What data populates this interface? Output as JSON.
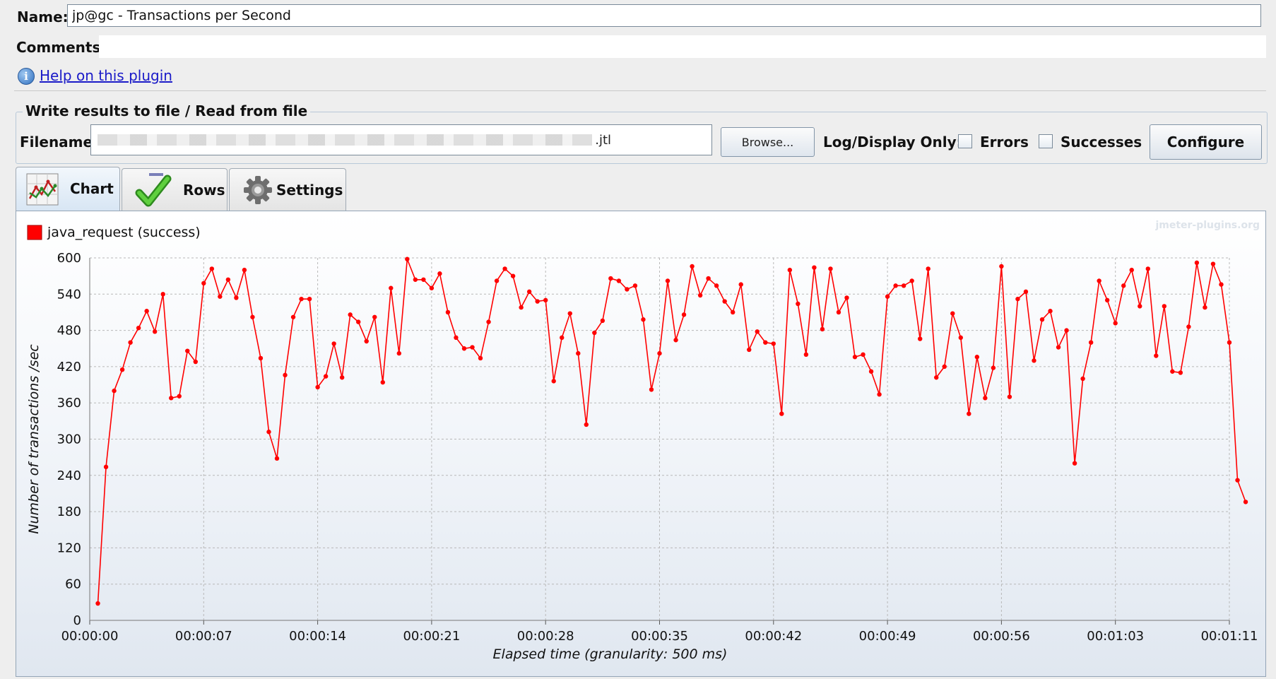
{
  "form": {
    "name_label": "Name:",
    "name_value": "jp@gc - Transactions per Second",
    "comments_label": "Comments:",
    "help_link": "Help on this plugin"
  },
  "file_panel": {
    "legend": "Write results to file / Read from file",
    "filename_label": "Filename",
    "filename_value": ".jtl",
    "browse_label": "Browse...",
    "log_display_label": "Log/Display Only:",
    "errors_label": "Errors",
    "errors_checked": false,
    "successes_label": "Successes",
    "successes_checked": false,
    "configure_label": "Configure"
  },
  "tabs": [
    {
      "label": "Chart",
      "icon": "chart-icon",
      "active": true
    },
    {
      "label": "Rows",
      "icon": "checkmark-icon",
      "active": false
    },
    {
      "label": "Settings",
      "icon": "gear-icon",
      "active": false
    }
  ],
  "colors": {
    "series": "#ff0000",
    "grid": "#b8b8b8"
  },
  "chart_data": {
    "type": "line",
    "watermark": "jmeter-plugins.org",
    "ylabel": "Number of transactions /sec",
    "xlabel": "Elapsed time (granularity: 500 ms)",
    "ylim": [
      0,
      600
    ],
    "yticks": [
      0,
      60,
      120,
      180,
      240,
      300,
      360,
      420,
      480,
      540,
      600
    ],
    "xlim": [
      0,
      70
    ],
    "xticks": [
      {
        "value": 0,
        "label": "00:00:00"
      },
      {
        "value": 7,
        "label": "00:00:07"
      },
      {
        "value": 14,
        "label": "00:00:14"
      },
      {
        "value": 21,
        "label": "00:00:21"
      },
      {
        "value": 28,
        "label": "00:00:28"
      },
      {
        "value": 35,
        "label": "00:00:35"
      },
      {
        "value": 42,
        "label": "00:00:42"
      },
      {
        "value": 49,
        "label": "00:00:49"
      },
      {
        "value": 56,
        "label": "00:00:56"
      },
      {
        "value": 63,
        "label": "00:01:03"
      },
      {
        "value": 70,
        "label": "00:01:11"
      }
    ],
    "grid": true,
    "legend_position": "top-left",
    "series": [
      {
        "name": "java_request (success)",
        "color": "#ff0000",
        "x_granularity_seconds": 0.5,
        "values": [
          28,
          254,
          380,
          415,
          460,
          484,
          512,
          478,
          540,
          368,
          371,
          446,
          428,
          558,
          582,
          536,
          564,
          534,
          580,
          502,
          434,
          312,
          268,
          406,
          502,
          532,
          532,
          386,
          404,
          458,
          402,
          506,
          494,
          462,
          502,
          394,
          550,
          442,
          598,
          564,
          564,
          550,
          574,
          510,
          468,
          450,
          452,
          434,
          494,
          562,
          582,
          570,
          518,
          544,
          528,
          530,
          396,
          468,
          508,
          442,
          324,
          476,
          496,
          566,
          562,
          548,
          554,
          498,
          382,
          442,
          562,
          464,
          506,
          586,
          538,
          566,
          554,
          528,
          510,
          556,
          448,
          478,
          460,
          458,
          342,
          580,
          524,
          440,
          584,
          482,
          582,
          510,
          534,
          436,
          440,
          412,
          374,
          536,
          554,
          554,
          562,
          466,
          582,
          402,
          420,
          508,
          468,
          342,
          436,
          368,
          418,
          586,
          370,
          532,
          544,
          430,
          498,
          512,
          452,
          480,
          260,
          400,
          460,
          562,
          530,
          492,
          554,
          580,
          520,
          582,
          438,
          520,
          412,
          410,
          486,
          592,
          518,
          590,
          556,
          460,
          232,
          196
        ]
      }
    ]
  }
}
